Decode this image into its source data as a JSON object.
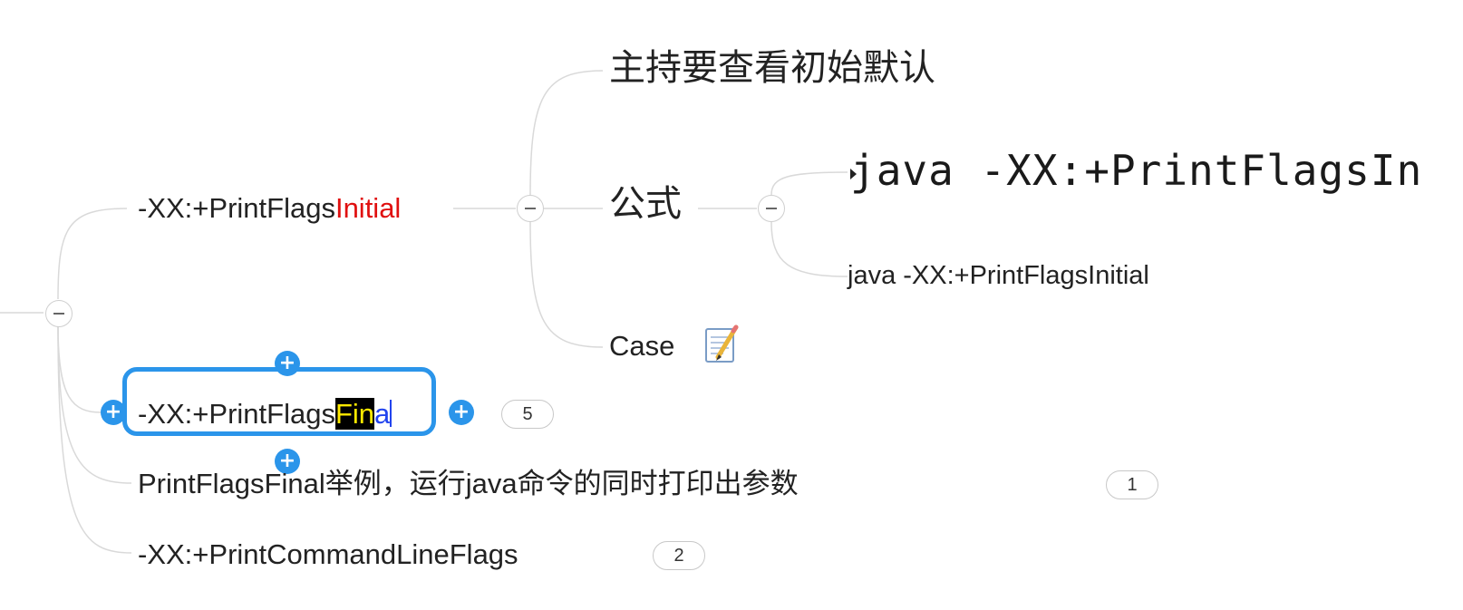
{
  "mindmap": {
    "branches": [
      {
        "label_prefix": "-XX:+PrintFlags",
        "label_suffix": "Initial",
        "suffix_color": "#e01010"
      },
      {
        "label_prefix": "-XX:+PrintFlags",
        "highlight": "Fin",
        "rest": "a",
        "caret_char": "l",
        "badge": "5",
        "editing": true
      },
      {
        "label": "PrintFlagsFinal举例，运行java命令的同时打印出参数",
        "badge": "1"
      },
      {
        "label": "-XX:+PrintCommandLineFlags",
        "badge": "2"
      }
    ],
    "initial_children": {
      "desc": "主持要查看初始默认",
      "formula": "公式",
      "case": "Case",
      "case_icon": "note-edit-icon"
    },
    "formula_children": {
      "code_image_text": "java -XX:+PrintFlagsIn",
      "command": "java -XX:+PrintFlagsInitial"
    },
    "colors": {
      "line": "#d9d9d9",
      "selection": "#2b95ea",
      "highlight_bg": "#000000",
      "highlight_fg": "#ffea00"
    }
  }
}
